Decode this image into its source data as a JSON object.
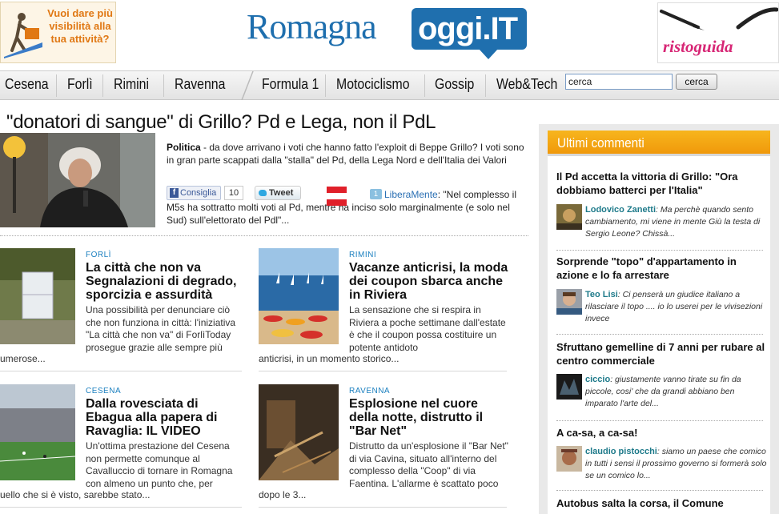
{
  "header": {
    "ad_left_text": "Vuoi dare più visibilità alla tua attività?",
    "logo_part1": "Romagna",
    "logo_part2": "oggi.IT",
    "ad_right_brand": "ristoguida"
  },
  "nav": {
    "items": [
      "Cesena",
      "Forlì",
      "Rimini",
      "Ravenna",
      "Formula 1",
      "Motociclismo",
      "Gossip",
      "Web&Tech"
    ],
    "search_value": "cerca",
    "search_button": "cerca"
  },
  "lead": {
    "title": "\"donatori di sangue\" di Grillo? Pd e Lega, non il PdL",
    "category": "Politica",
    "summary": " - da dove arrivano i voti che hanno fatto l'exploit di Beppe Grillo? I voti sono in gran parte scappati dalla \"stalla\" del Pd, della Lega Nord e dell'Italia dei Valori",
    "fb_label": "Consiglia",
    "fb_count": "10",
    "tweet_label": "Tweet",
    "related_count": "1",
    "related_source": "LiberaMente",
    "related_text": ": \"Nel complesso il M5s ha sottratto molti voti al Pd, mentre ha inciso solo marginalmente (e solo nel Sud) sull'elettorato del Pdl\"..."
  },
  "stories": [
    {
      "category": "FORLÌ",
      "title": "La città che non va Segnalazioni di degrado, sporcizia e assurdità",
      "text": "Una possibilità per denunciare ciò che non funziona in città: l'iniziativa \"La città che non va\" di ForlìToday prosegue grazie alle sempre più",
      "tail": "umerose..."
    },
    {
      "category": "RIMINI",
      "title": "Vacanze anticrisi, la moda dei coupon sbarca anche in Riviera",
      "text": "La sensazione che si respira in Riviera a poche settimane dall'estate è che il coupon possa costituire un potente antidoto",
      "tail": "anticrisi, in un momento storico..."
    },
    {
      "category": "CESENA",
      "title": "Dalla rovesciata di Ebagua alla papera di Ravaglia: IL VIDEO",
      "text": "Un'ottima prestazione del Cesena non permette comunque al Cavalluccio di tornare in Romagna con almeno un punto che, per",
      "tail": "uello che si è visto, sarebbe stato..."
    },
    {
      "category": "RAVENNA",
      "title": "Esplosione nel cuore della notte, distrutto il \"Bar Net\"",
      "text": "Distrutto da un'esplosione il \"Bar Net\" di via Cavina, situato all'interno del complesso della \"Coop\" di via Faentina. L'allarme è scattato poco",
      "tail": "dopo le 3..."
    }
  ],
  "sidebar": {
    "heading": "Ultimi commenti",
    "comments": [
      {
        "title": "Il Pd accetta la vittoria di Grillo: \"Ora dobbiamo batterci per l'Italia\"",
        "author": "Lodovico Zanetti",
        "text": ": Ma perchè quando sento cambiamento, mi viene in mente Giù la testa di Sergio Leone? Chissà..."
      },
      {
        "title": "Sorprende \"topo\" d'appartamento in azione e lo fa arrestare",
        "author": "Teo Lisi",
        "text": ": Ci penserà un giudice italiano a rilasciare il topo .... io lo userei per le vivisezioni invece"
      },
      {
        "title": "Sfruttano gemelline di 7 anni per rubare al centro commerciale",
        "author": "ciccio",
        "text": ": giustamente vanno tirate su fin da piccole, cosi' che da grandi abbiano ben imparato l'arte del..."
      },
      {
        "title": "A ca-sa, a ca-sa!",
        "author": "claudio pistocchi",
        "text": ": siamo un paese che comico in tutti i sensi il prossimo governo si formerà solo se un comico lo..."
      },
      {
        "title": "Autobus salta la corsa, il Comune",
        "author": "",
        "text": ""
      }
    ]
  },
  "colors": {
    "accent_blue": "#1f6fae",
    "category_blue": "#1a7fbf",
    "sidebar_orange": "#f4a812",
    "author_teal": "#1e7a8a",
    "ristoguida_pink": "#d72675"
  }
}
